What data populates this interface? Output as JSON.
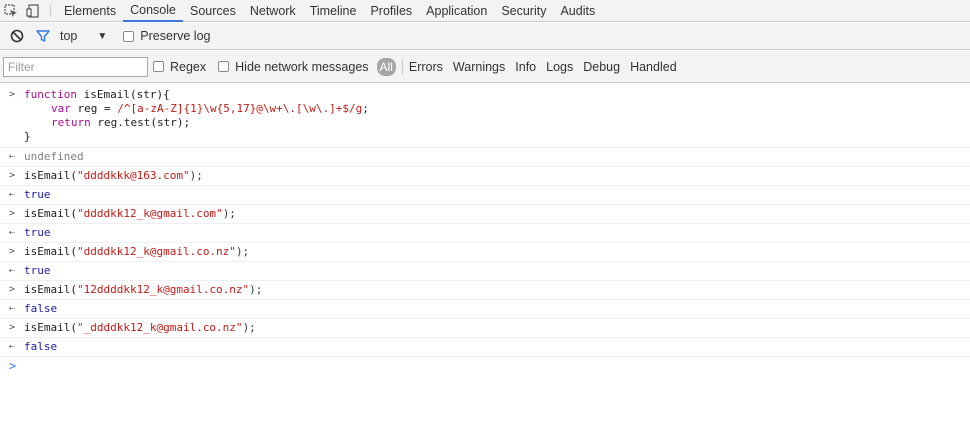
{
  "devtools": {
    "tabs": [
      "Elements",
      "Console",
      "Sources",
      "Network",
      "Timeline",
      "Profiles",
      "Application",
      "Security",
      "Audits"
    ],
    "active_tab": "Console"
  },
  "toolbar": {
    "context": "top",
    "preserve_log_label": "Preserve log"
  },
  "filterbar": {
    "filter_placeholder": "Filter",
    "regex_label": "Regex",
    "hide_network_label": "Hide network messages",
    "levels": [
      "All",
      "Errors",
      "Warnings",
      "Info",
      "Logs",
      "Debug",
      "Handled"
    ]
  },
  "console": {
    "code": {
      "line1_kw": "function",
      "line1_rest": " isEmail(str){",
      "line2_kw": "var",
      "line2_mid": " reg = ",
      "line2_regex": "/^[a-zA-Z]{1}\\w{5,17}@\\w+\\.[\\w\\.]+$/g",
      "line2_end": ";",
      "line3_kw": "return",
      "line3_rest": " reg.test(str);",
      "line4": "}"
    },
    "undefined_output": "undefined",
    "calls": [
      {
        "prefix": "isEmail(",
        "arg": "\"ddddkkk@163.com\"",
        "suffix": ");",
        "result": "true"
      },
      {
        "prefix": "isEmail(",
        "arg": "\"ddddkk12_k@gmail.com\"",
        "suffix": ");",
        "result": "true"
      },
      {
        "prefix": "isEmail(",
        "arg": "\"ddddkk12_k@gmail.co.nz\"",
        "suffix": ");",
        "result": "true"
      },
      {
        "prefix": "isEmail(",
        "arg": "\"12ddddkk12_k@gmail.co.nz\"",
        "suffix": ");",
        "result": "false"
      },
      {
        "prefix": "isEmail(",
        "arg": "\"_ddddkk12_k@gmail.co.nz\"",
        "suffix": ");",
        "result": "false"
      }
    ]
  }
}
